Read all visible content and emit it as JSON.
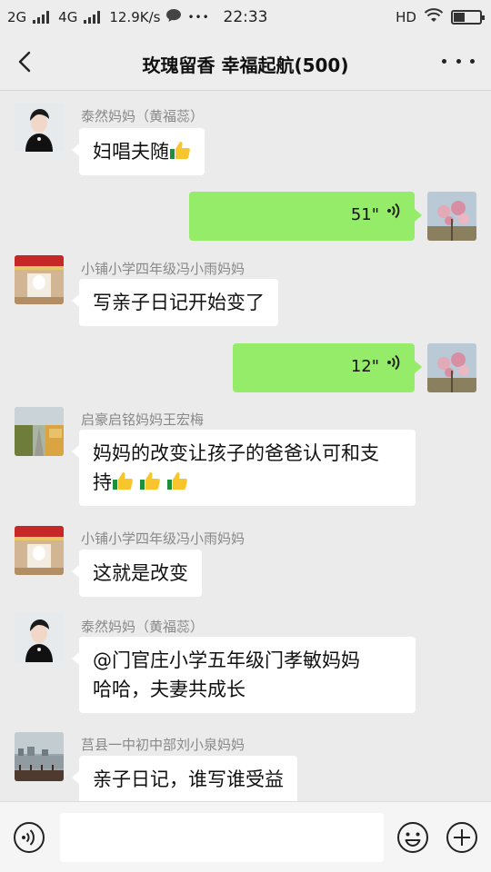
{
  "status_bar": {
    "net1": "2G",
    "net2": "4G",
    "speed": "12.9K/s",
    "dots": "•••",
    "time": "22:33",
    "hd": "HD"
  },
  "header": {
    "title": "玫瑰留香  幸福起航(500)"
  },
  "messages": [
    {
      "side": "left",
      "sender": "泰然妈妈（黄福蕊）",
      "text": "妇唱夫随",
      "emoji": [
        "thumbs-up"
      ]
    },
    {
      "side": "right",
      "type": "voice",
      "duration": "51\""
    },
    {
      "side": "left",
      "sender": "小铺小学四年级冯小雨妈妈",
      "text": "写亲子日记开始变了"
    },
    {
      "side": "right",
      "type": "voice",
      "duration": "12\""
    },
    {
      "side": "left",
      "sender": "启豪启铭妈妈王宏梅",
      "line1": "妈妈的改变让孩子的爸爸认可和支",
      "line2": "持",
      "emoji": [
        "thumbs-up",
        "thumbs-up",
        "thumbs-up"
      ]
    },
    {
      "side": "left",
      "sender": "小铺小学四年级冯小雨妈妈",
      "text": "这就是改变"
    },
    {
      "side": "left",
      "sender": "泰然妈妈（黄福蕊）",
      "line1": "@门官庄小学五年级门孝敏妈妈",
      "line2": "哈哈，夫妻共成长"
    },
    {
      "side": "left",
      "sender": "莒县一中初中部刘小泉妈妈",
      "text": "亲子日记，谁写谁受益"
    }
  ],
  "input_bar": {
    "placeholder": ""
  },
  "colors": {
    "self_bubble": "#95ec69",
    "other_bubble": "#ffffff",
    "background": "#ebebeb"
  }
}
